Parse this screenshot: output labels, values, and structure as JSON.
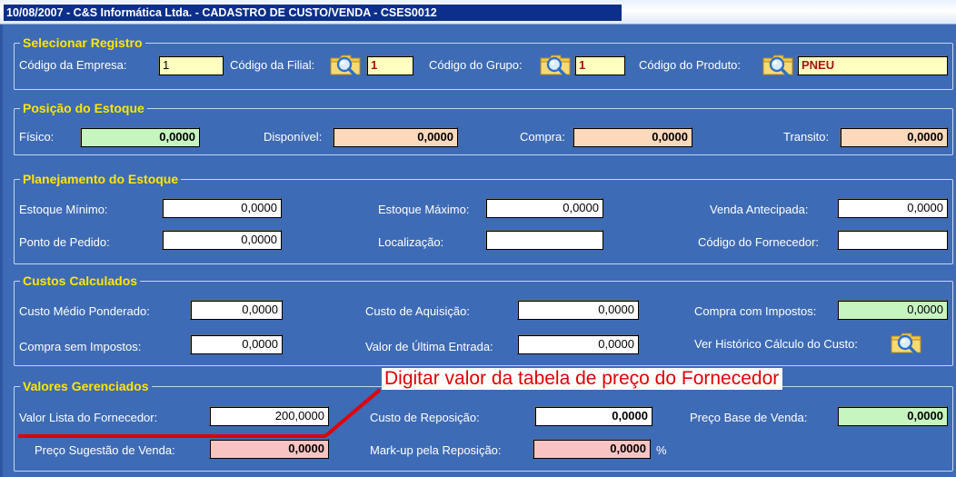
{
  "window": {
    "title": "10/08/2007  -  C&S Informática Ltda.  -  CADASTRO DE CUSTO/VENDA  -  CSES0012"
  },
  "selecionar": {
    "legend": "Selecionar Registro",
    "empresa_label": "Código da Empresa:",
    "empresa_value": "1",
    "filial_label": "Código da Filial:",
    "filial_value": "1",
    "grupo_label": "Código do Grupo:",
    "grupo_value": "1",
    "produto_label": "Código do Produto:",
    "produto_value": "PNEU"
  },
  "posicao": {
    "legend": "Posição do Estoque",
    "fisico_label": "Físico:",
    "fisico_value": "0,0000",
    "disponivel_label": "Disponível:",
    "disponivel_value": "0,0000",
    "compra_label": "Compra:",
    "compra_value": "0,0000",
    "transito_label": "Transito:",
    "transito_value": "0,0000"
  },
  "planejamento": {
    "legend": "Planejamento do Estoque",
    "minimo_label": "Estoque Mínimo:",
    "minimo_value": "0,0000",
    "maximo_label": "Estoque Máximo:",
    "maximo_value": "0,0000",
    "venda_label": "Venda Antecipada:",
    "venda_value": "0,0000",
    "ponto_label": "Ponto de Pedido:",
    "ponto_value": "0,0000",
    "localizacao_label": "Localização:",
    "localizacao_value": "",
    "fornecedor_label": "Código do  Fornecedor:",
    "fornecedor_value": ""
  },
  "custos": {
    "legend": "Custos Calculados",
    "medio_label": "Custo Médio Ponderado:",
    "medio_value": "0,0000",
    "aquisicao_label": "Custo de Aquisição:",
    "aquisicao_value": "0,0000",
    "compra_com_label": "Compra com Impostos:",
    "compra_com_value": "0,0000",
    "compra_sem_label": "Compra sem Impostos:",
    "compra_sem_value": "0,0000",
    "ultima_label": "Valor de Última Entrada:",
    "ultima_value": "0,0000",
    "historico_label": "Ver Histórico Cálculo do Custo:"
  },
  "valores": {
    "legend": "Valores Gerenciados",
    "lista_label": "Valor Lista do Fornecedor:",
    "lista_value": "200,0000",
    "reposicao_label": "Custo de Reposição:",
    "reposicao_value": "0,0000",
    "base_label": "Preço Base de Venda:",
    "base_value": "0,0000",
    "sugestao_label": "Preço Sugestão de Venda:",
    "sugestao_value": "0,0000",
    "markup_label": "Mark-up pela Reposição:",
    "markup_value": "0,0000",
    "markup_unit": "%"
  },
  "annotation": {
    "text": "Digitar valor da tabela de preço do Fornecedor",
    "color": "#e00000"
  },
  "icons": [
    "search-folder-icon"
  ],
  "colors": {
    "background": "#3e6bb5",
    "legend": "#ffe600",
    "field_yellow": "#ffffc0",
    "field_green": "#c6f5c0",
    "field_peach": "#fcd9bb",
    "field_pink": "#f9c3c3"
  }
}
